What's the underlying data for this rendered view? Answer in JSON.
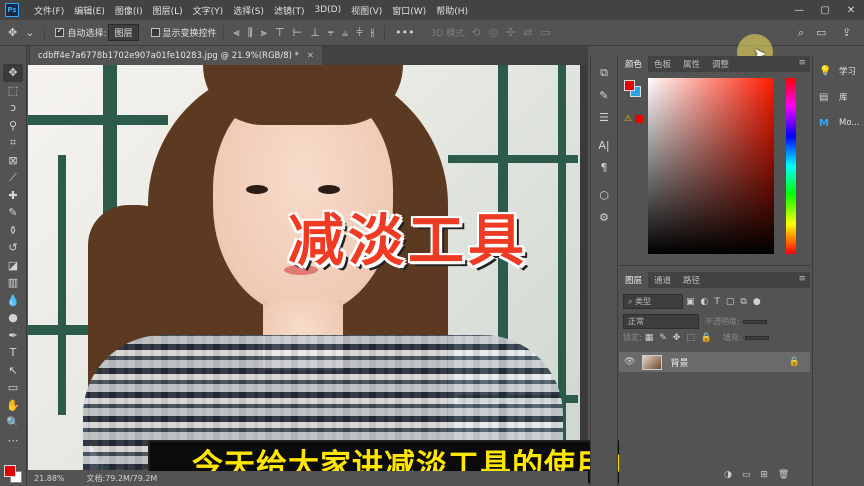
{
  "app": {
    "logo": "Ps",
    "menu": [
      "文件(F)",
      "编辑(E)",
      "图像(I)",
      "图层(L)",
      "文字(Y)",
      "选择(S)",
      "滤镜(T)",
      "3D(D)",
      "视图(V)",
      "窗口(W)",
      "帮助(H)"
    ]
  },
  "options": {
    "auto_select_label": "自动选择:",
    "auto_select_value": "图层",
    "show_transform_label": "显示变换控件",
    "mode_3d_label": "3D 模式:"
  },
  "document": {
    "tab_title": "cdbff4e7a6778b1702e907a01fe10283.jpg @ 21.9%(RGB/8) *",
    "overlay_title": "减淡工具",
    "subtitle": "今天给大家讲减淡工具的使用方法"
  },
  "statusbar": {
    "zoom": "21.88%",
    "doc_info": "文档:79.2M/79.2M"
  },
  "color_panel": {
    "tabs": [
      "颜色",
      "色板",
      "属性",
      "调整"
    ],
    "foreground_color": "#e40000",
    "background_color": "#2aa7e0"
  },
  "layers_panel": {
    "tabs": [
      "图层",
      "通道",
      "路径"
    ],
    "filter_label": "类型",
    "blend_mode": "正常",
    "opacity_label": "不透明度:",
    "lock_label": "锁定:",
    "fill_label": "填充:",
    "layers": [
      {
        "name": "背景",
        "visible": true,
        "locked": true
      }
    ]
  },
  "right_panel": {
    "items": [
      {
        "icon": "bulb-icon",
        "label": "学习"
      },
      {
        "icon": "library-icon",
        "label": "库"
      },
      {
        "icon": "mo-icon",
        "label": "Mo..."
      }
    ]
  },
  "colors": {
    "ui_dark": "#535353",
    "menubar": "#434343",
    "accent_red": "#ef3b24",
    "subtitle_yellow": "#ffe600"
  }
}
